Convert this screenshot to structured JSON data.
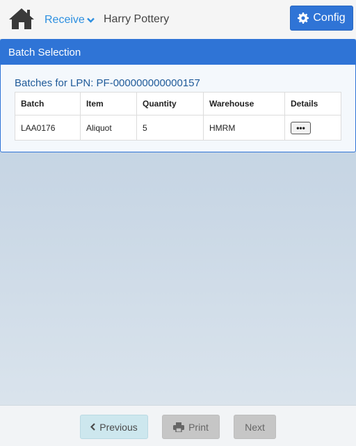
{
  "navbar": {
    "home_icon": "home-icon",
    "receive_label": "Receive",
    "user_name": "Harry Pottery",
    "config_label": "Config",
    "colors": {
      "accent": "#2f74d6",
      "link": "#2d8fe0"
    }
  },
  "panel": {
    "heading": "Batch Selection",
    "batches_title": "Batches for LPN: PF-000000000000157",
    "columns": [
      "Batch",
      "Item",
      "Quantity",
      "Warehouse",
      "Details"
    ],
    "rows": [
      {
        "batch": "LAA0176",
        "item": "Aliquot",
        "quantity": "5",
        "warehouse": "HMRM",
        "details": "•••"
      }
    ]
  },
  "footer": {
    "previous_label": "Previous",
    "print_label": "Print",
    "next_label": "Next"
  }
}
